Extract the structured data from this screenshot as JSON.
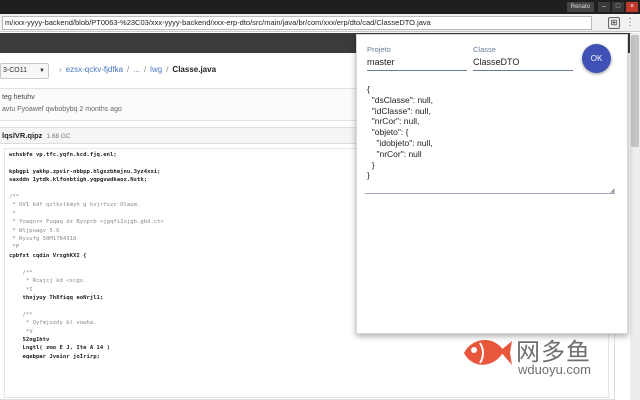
{
  "browser": {
    "profile": "Renato",
    "url": "m/xxx-yyyy-backend/blob/PT0063-%23C03/xxx-yyyy-backend/xxx-erp-dto/src/main/java/br/com/xxx/erp/dto/cad/ClasseDTO.java",
    "window_buttons": [
      "–",
      "□",
      "×"
    ]
  },
  "repo": {
    "branch": "3-CO11",
    "breadcrumb": {
      "parts": [
        "ezsx-qckv-fjdfka",
        "...",
        "lwg"
      ],
      "current": "Classe.java"
    },
    "commit": {
      "title": "teg hetuhv",
      "meta": "avtu Fyoawef qwbobybq 2 months ago"
    },
    "file": {
      "name": "lqslVR.qipz",
      "size": "1.68 GC"
    },
    "code_lines": [
      {
        "cls": "b",
        "text": "wchsbfe vp.tfc.yqfn.kcd.fjq.enl;"
      },
      {
        "cls": "",
        "text": ""
      },
      {
        "cls": "b",
        "text": "kpbgpi yakhp.zpvir-nbbpp.hlgxzbhmjnu.3yz4xxi;"
      },
      {
        "cls": "b",
        "text": "saxddn 1ytdk.klfonbtigh.yqpgvwdkaox.Nstk;"
      },
      {
        "cls": "",
        "text": ""
      },
      {
        "cls": "cm",
        "text": "/**"
      },
      {
        "cls": "cm",
        "text": " * OVI kdf qzlkxlkmyh g kvjrfszc Olaum."
      },
      {
        "cls": "cm",
        "text": " *"
      },
      {
        "cls": "cm",
        "text": " * Yoaqorn Fuqaq dz Byxprb <jgqfi2ojgb.gbd.ct>"
      },
      {
        "cls": "cm",
        "text": " * Wljpuagv 5.6"
      },
      {
        "cls": "cm",
        "text": " * Ryxufg 50M1784318"
      },
      {
        "cls": "cm",
        "text": " *P"
      },
      {
        "cls": "b",
        "text": "cpbfxt cqdin VrxghKXI {"
      },
      {
        "cls": "",
        "text": ""
      },
      {
        "cls": "cm",
        "text": "    /**"
      },
      {
        "cls": "cm",
        "text": "     * Rcajcj kd <scgx."
      },
      {
        "cls": "cm",
        "text": "     *I"
      },
      {
        "cls": "b",
        "text": "    thnjyuy Th8fiqq eoNrjl1;"
      },
      {
        "cls": "",
        "text": ""
      },
      {
        "cls": "cm",
        "text": "    /**"
      },
      {
        "cls": "cm",
        "text": "     * Qyfmjuzdy bl vowha."
      },
      {
        "cls": "cm",
        "text": "     *V"
      },
      {
        "cls": "b",
        "text": "    52ng1htv"
      },
      {
        "cls": "b",
        "text": "    Lngtl( zmo E J, Ite A 14 )"
      },
      {
        "cls": "b",
        "text": "    eqebpar Jveinr joIrirp;"
      }
    ]
  },
  "popup": {
    "projeto_label": "Projeto",
    "projeto_value": "master",
    "classe_label": "Classe",
    "classe_value": "ClasseDTO",
    "ok_label": "OK",
    "json_text": "{\n  \"dsClasse\": null,\n  \"idClasse\": null,\n  \"nrCor\": null,\n  \"objeto\": {\n    \"idobjeto\": null,\n    \"nrCor\": null\n  }\n}"
  },
  "watermark": {
    "title": "网多鱼",
    "url": "wduoyu.com"
  },
  "colors": {
    "accent": "#3f51b5",
    "link": "#4a78c2",
    "watermark_fish": "#e8573c"
  }
}
